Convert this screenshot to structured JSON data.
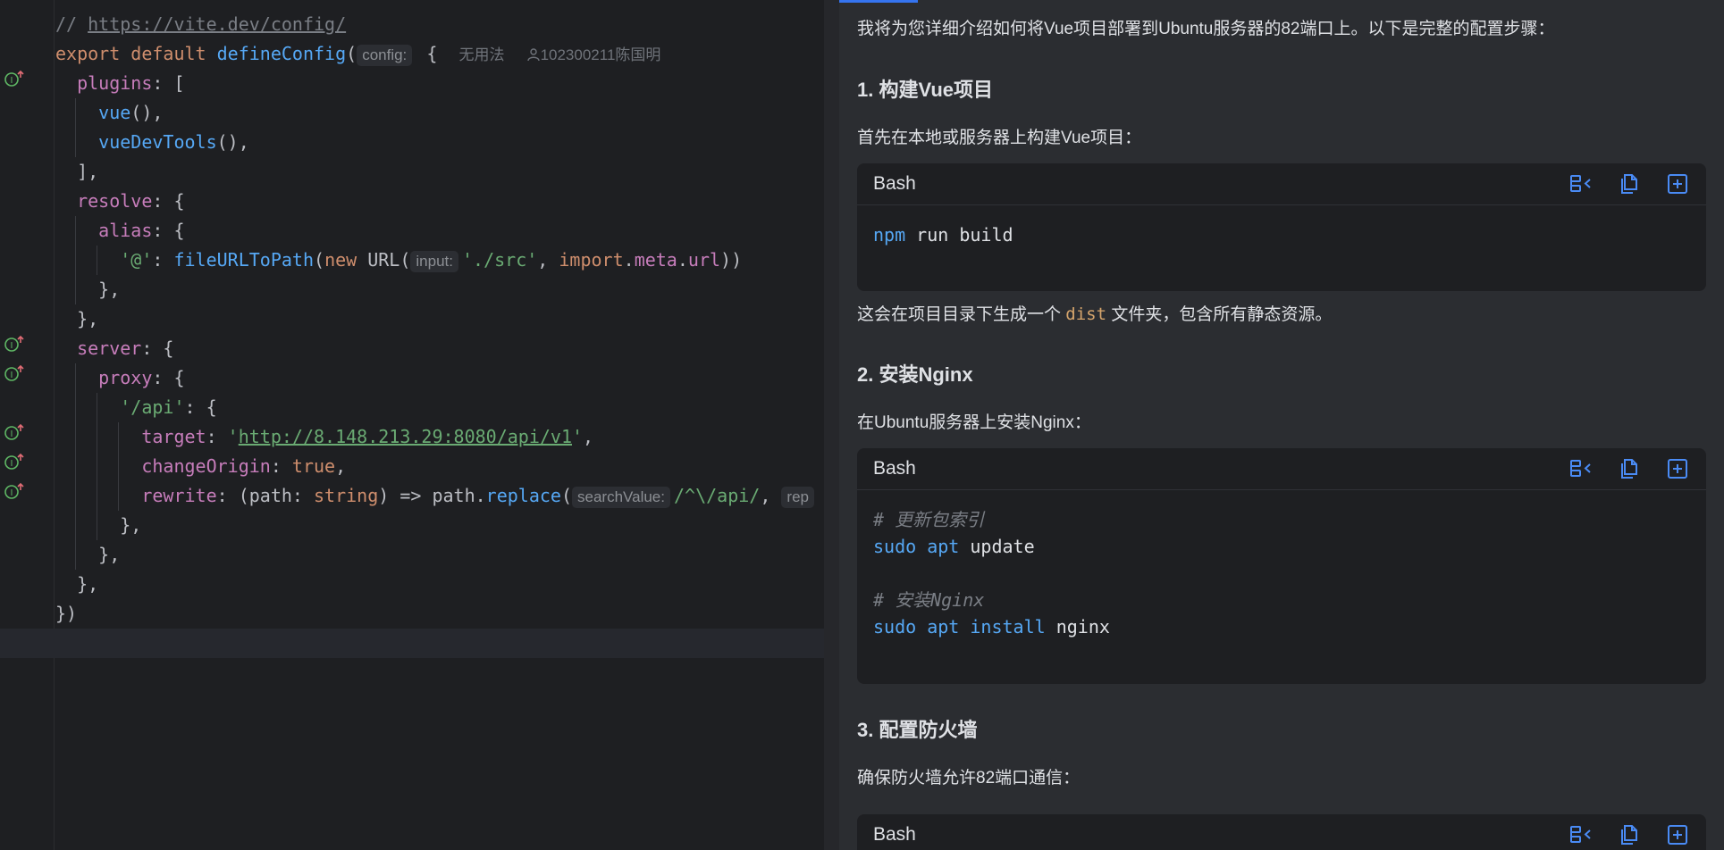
{
  "editor": {
    "lines": {
      "l1_comment_prefix": "// ",
      "l1_url": "https://vite.dev/config/",
      "l2_export": "export",
      "l2_default": "default",
      "l2_fn": "defineConfig",
      "l2_paren": "(",
      "l2_hint": "config:",
      "l2_brace": " {",
      "l2_usages": "无用法",
      "l2_author": "102300211陈国明",
      "l3_prop": "plugins",
      "l3_rest": ": [",
      "l4_fn": "vue",
      "l4_rest": "(),",
      "l5_fn": "vueDevTools",
      "l5_rest": "(),",
      "l6": "],",
      "l7_prop": "resolve",
      "l7_rest": ": {",
      "l8_prop": "alias",
      "l8_rest": ": {",
      "l9_key": "'@'",
      "l9_colon": ": ",
      "l9_fn": "fileURLToPath",
      "l9_p1": "(",
      "l9_new": "new",
      "l9_url": " URL(",
      "l9_hint": "input:",
      "l9_str": "'./src'",
      "l9_comma": ", ",
      "l9_import": "import",
      "l9_dot1": ".",
      "l9_meta": "meta",
      "l9_dot2": ".",
      "l9_urlprop": "url",
      "l9_close": "))",
      "l10": "},",
      "l11": "},",
      "l12_prop": "server",
      "l12_rest": ": {",
      "l13_prop": "proxy",
      "l13_rest": ": {",
      "l14_key": "'/api'",
      "l14_rest": ": {",
      "l15_prop": "target",
      "l15_colon": ": ",
      "l15_q1": "'",
      "l15_url": "http://8.148.213.29:8080/api/v1",
      "l15_q2": "'",
      "l15_comma": ",",
      "l16_prop": "changeOrigin",
      "l16_colon": ": ",
      "l16_val": "true",
      "l16_comma": ",",
      "l17_prop": "rewrite",
      "l17_a": ": (path: ",
      "l17_type": "string",
      "l17_b": ") => path.",
      "l17_fn": "replace",
      "l17_p": "(",
      "l17_hint": "searchValue:",
      "l17_regex": "/^\\/api/",
      "l17_comma": ", ",
      "l17_hint2": "rep",
      "l18": "},",
      "l19": "},",
      "l20": "},",
      "l21": "})"
    }
  },
  "chat": {
    "intro": "我将为您详细介绍如何将Vue项目部署到Ubuntu服务器的82端口上。以下是完整的配置步骤：",
    "s1_title": "1. 构建Vue项目",
    "s1_desc": "首先在本地或服务器上构建Vue项目：",
    "cb1_lang": "Bash",
    "cb1_cmd": "npm",
    "cb1_rest": " run build",
    "s1_after_a": "这会在项目目录下生成一个 ",
    "s1_after_code": "dist",
    "s1_after_b": " 文件夹，包含所有静态资源。",
    "s2_title": "2. 安装Nginx",
    "s2_desc": "在Ubuntu服务器上安装Nginx：",
    "cb2_lang": "Bash",
    "cb2_c1": "# 更新包索引",
    "cb2_l2_sudo": "sudo",
    "cb2_l2_apt": "apt",
    "cb2_l2_rest": " update",
    "cb2_c2": "# 安装Nginx",
    "cb2_l4_sudo": "sudo",
    "cb2_l4_apt": "apt",
    "cb2_l4_install": "install",
    "cb2_l4_rest": " nginx",
    "s3_title": "3. 配置防火墙",
    "s3_desc": "确保防火墙允许82端口通信：",
    "cb3_lang": "Bash"
  },
  "colors": {
    "accent": "#3574f0",
    "editor_bg": "#1e1f22",
    "panel_bg": "#2b2d31",
    "keyword": "#cf8e6d",
    "function": "#56a8f5",
    "property": "#c77dbb",
    "string": "#6aab73",
    "gutter_icon": "#5fb865"
  },
  "icons": [
    "implements-override-icon",
    "insert-at-caret-icon",
    "copy-icon",
    "new-file-icon",
    "user-icon"
  ]
}
